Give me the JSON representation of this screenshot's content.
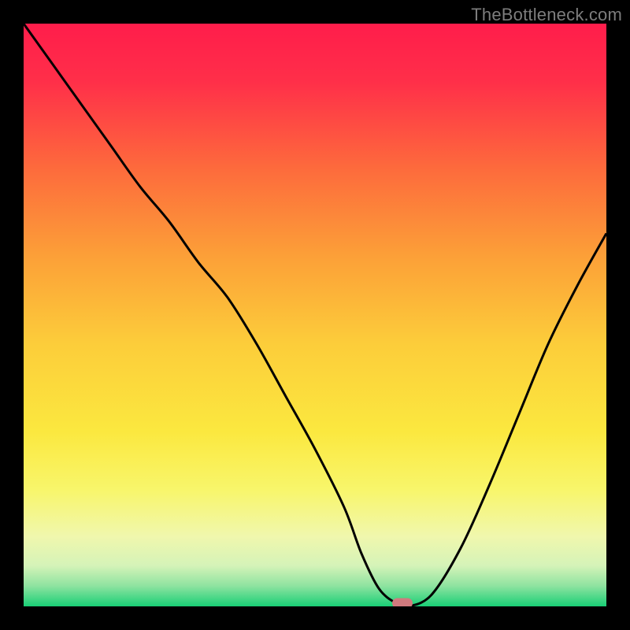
{
  "attribution": "TheBottleneck.com",
  "colors": {
    "gradient_stops": [
      {
        "offset": 0.0,
        "color": "#ff1d4b"
      },
      {
        "offset": 0.1,
        "color": "#ff2f49"
      },
      {
        "offset": 0.25,
        "color": "#fd6b3c"
      },
      {
        "offset": 0.4,
        "color": "#fca038"
      },
      {
        "offset": 0.55,
        "color": "#fccd3a"
      },
      {
        "offset": 0.7,
        "color": "#fbe83f"
      },
      {
        "offset": 0.8,
        "color": "#f8f66b"
      },
      {
        "offset": 0.88,
        "color": "#f0f7ad"
      },
      {
        "offset": 0.93,
        "color": "#d5f3b8"
      },
      {
        "offset": 0.965,
        "color": "#8ee3a0"
      },
      {
        "offset": 1.0,
        "color": "#19cf76"
      }
    ],
    "curve_stroke": "#000000",
    "marker_fill": "#d07a7e",
    "background": "#000000"
  },
  "chart_data": {
    "type": "line",
    "title": "",
    "xlabel": "",
    "ylabel": "",
    "xlim": [
      0,
      100
    ],
    "ylim": [
      0,
      100
    ],
    "x": [
      0,
      5,
      10,
      15,
      20,
      25,
      30,
      35,
      40,
      45,
      50,
      55,
      58,
      61,
      64,
      66,
      70,
      75,
      80,
      85,
      90,
      95,
      100
    ],
    "values": [
      100,
      93,
      86,
      79,
      72,
      66,
      59,
      53,
      45,
      36,
      27,
      17,
      9,
      3,
      0.5,
      0,
      2,
      10,
      21,
      33,
      45,
      55,
      64
    ],
    "marker": {
      "x": 65,
      "y": 0
    }
  }
}
